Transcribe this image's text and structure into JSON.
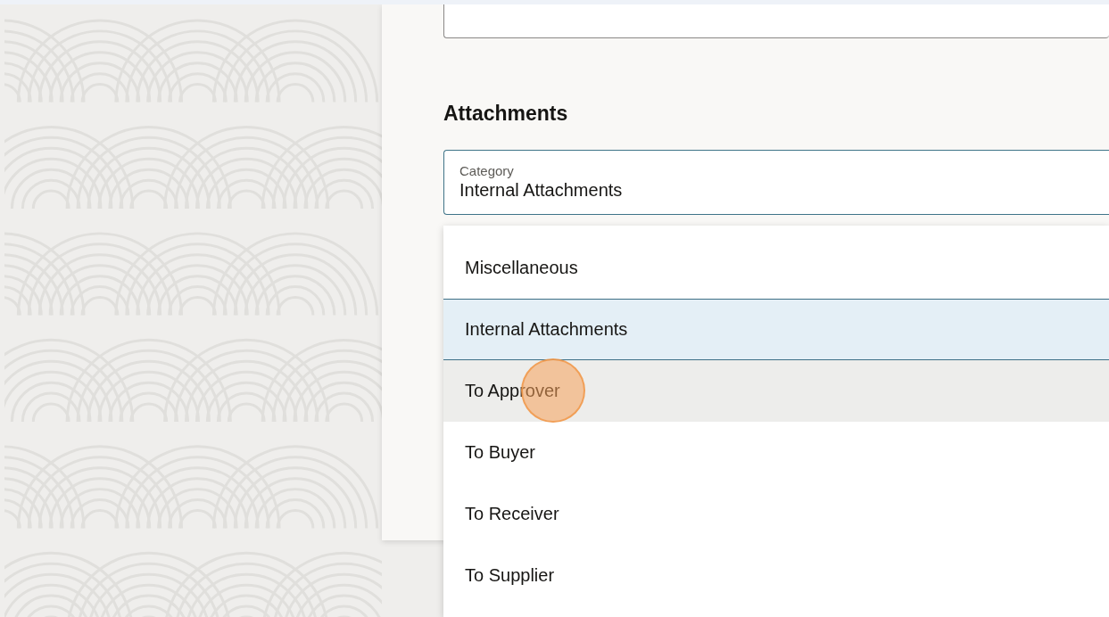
{
  "section": {
    "heading": "Attachments"
  },
  "category_field": {
    "label": "Category",
    "value": "Internal Attachments"
  },
  "dropdown": {
    "options": [
      {
        "label": "Miscellaneous",
        "selected": false,
        "hovered": false
      },
      {
        "label": "Internal Attachments",
        "selected": true,
        "hovered": false
      },
      {
        "label": "To Approver",
        "selected": false,
        "hovered": true
      },
      {
        "label": "To Buyer",
        "selected": false,
        "hovered": false
      },
      {
        "label": "To Receiver",
        "selected": false,
        "hovered": false
      },
      {
        "label": "To Supplier",
        "selected": false,
        "hovered": false
      }
    ]
  }
}
